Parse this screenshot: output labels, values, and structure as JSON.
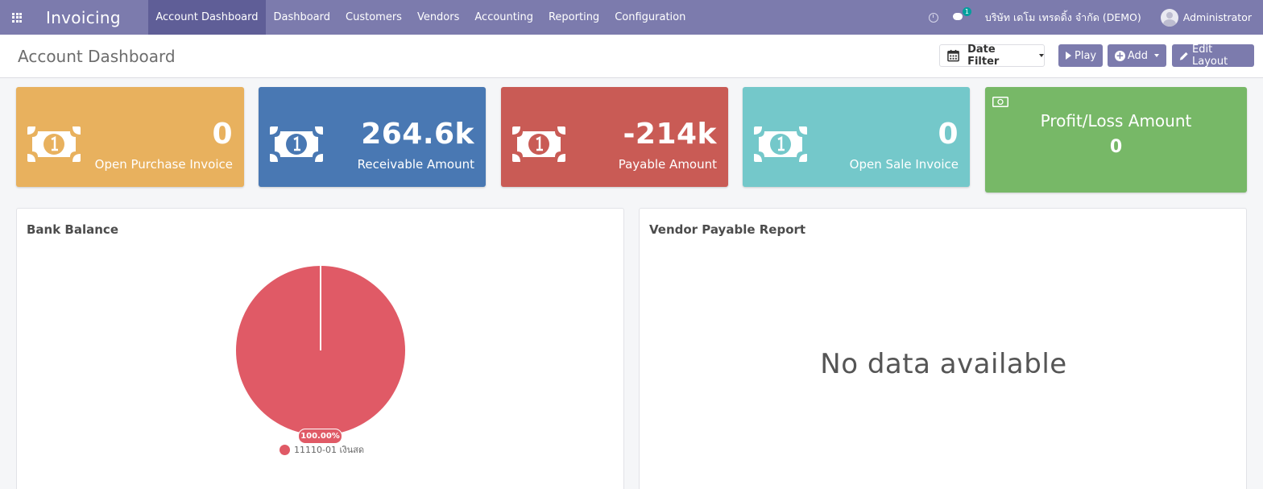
{
  "navbar": {
    "apps_icon": "apps-grid-icon",
    "brand": "Invoicing",
    "menu": [
      {
        "label": "Account Dashboard",
        "active": true
      },
      {
        "label": "Dashboard"
      },
      {
        "label": "Customers"
      },
      {
        "label": "Vendors"
      },
      {
        "label": "Accounting"
      },
      {
        "label": "Reporting"
      },
      {
        "label": "Configuration"
      }
    ],
    "messages_badge": "1",
    "company": "บริษัท เดโม เทรดดิ้ง จำกัด (DEMO)",
    "user": "Administrator",
    "color": "#7c7bad"
  },
  "control_panel": {
    "title": "Account Dashboard",
    "date_filter_label": "Date Filter",
    "play_label": "Play",
    "add_label": "Add",
    "edit_layout_label": "Edit Layout"
  },
  "tiles": [
    {
      "value": "0",
      "label": "Open Purchase Invoice",
      "color": "#e8b15e",
      "icon": "money-bill-icon"
    },
    {
      "value": "264.6k",
      "label": "Receivable Amount",
      "color": "#4978b3",
      "icon": "money-bill-icon"
    },
    {
      "value": "-214k",
      "label": "Payable Amount",
      "color": "#c95b55",
      "icon": "money-bill-icon"
    },
    {
      "value": "0",
      "label": "Open Sale Invoice",
      "color": "#74c8ca",
      "icon": "money-bill-icon"
    }
  ],
  "profit_loss": {
    "title": "Profit/Loss Amount",
    "value": "0",
    "color": "#77b867",
    "icon": "money-bill-icon"
  },
  "bank_balance": {
    "title": "Bank Balance",
    "chart_data": {
      "type": "pie",
      "categories": [
        "11110-01 เงินสด"
      ],
      "values": [
        100
      ],
      "data_labels": [
        "100.00%"
      ],
      "colors": [
        "#e05a66"
      ],
      "legend": "bottom"
    }
  },
  "vendor_payable": {
    "title": "Vendor Payable Report",
    "empty_text": "No data available"
  }
}
